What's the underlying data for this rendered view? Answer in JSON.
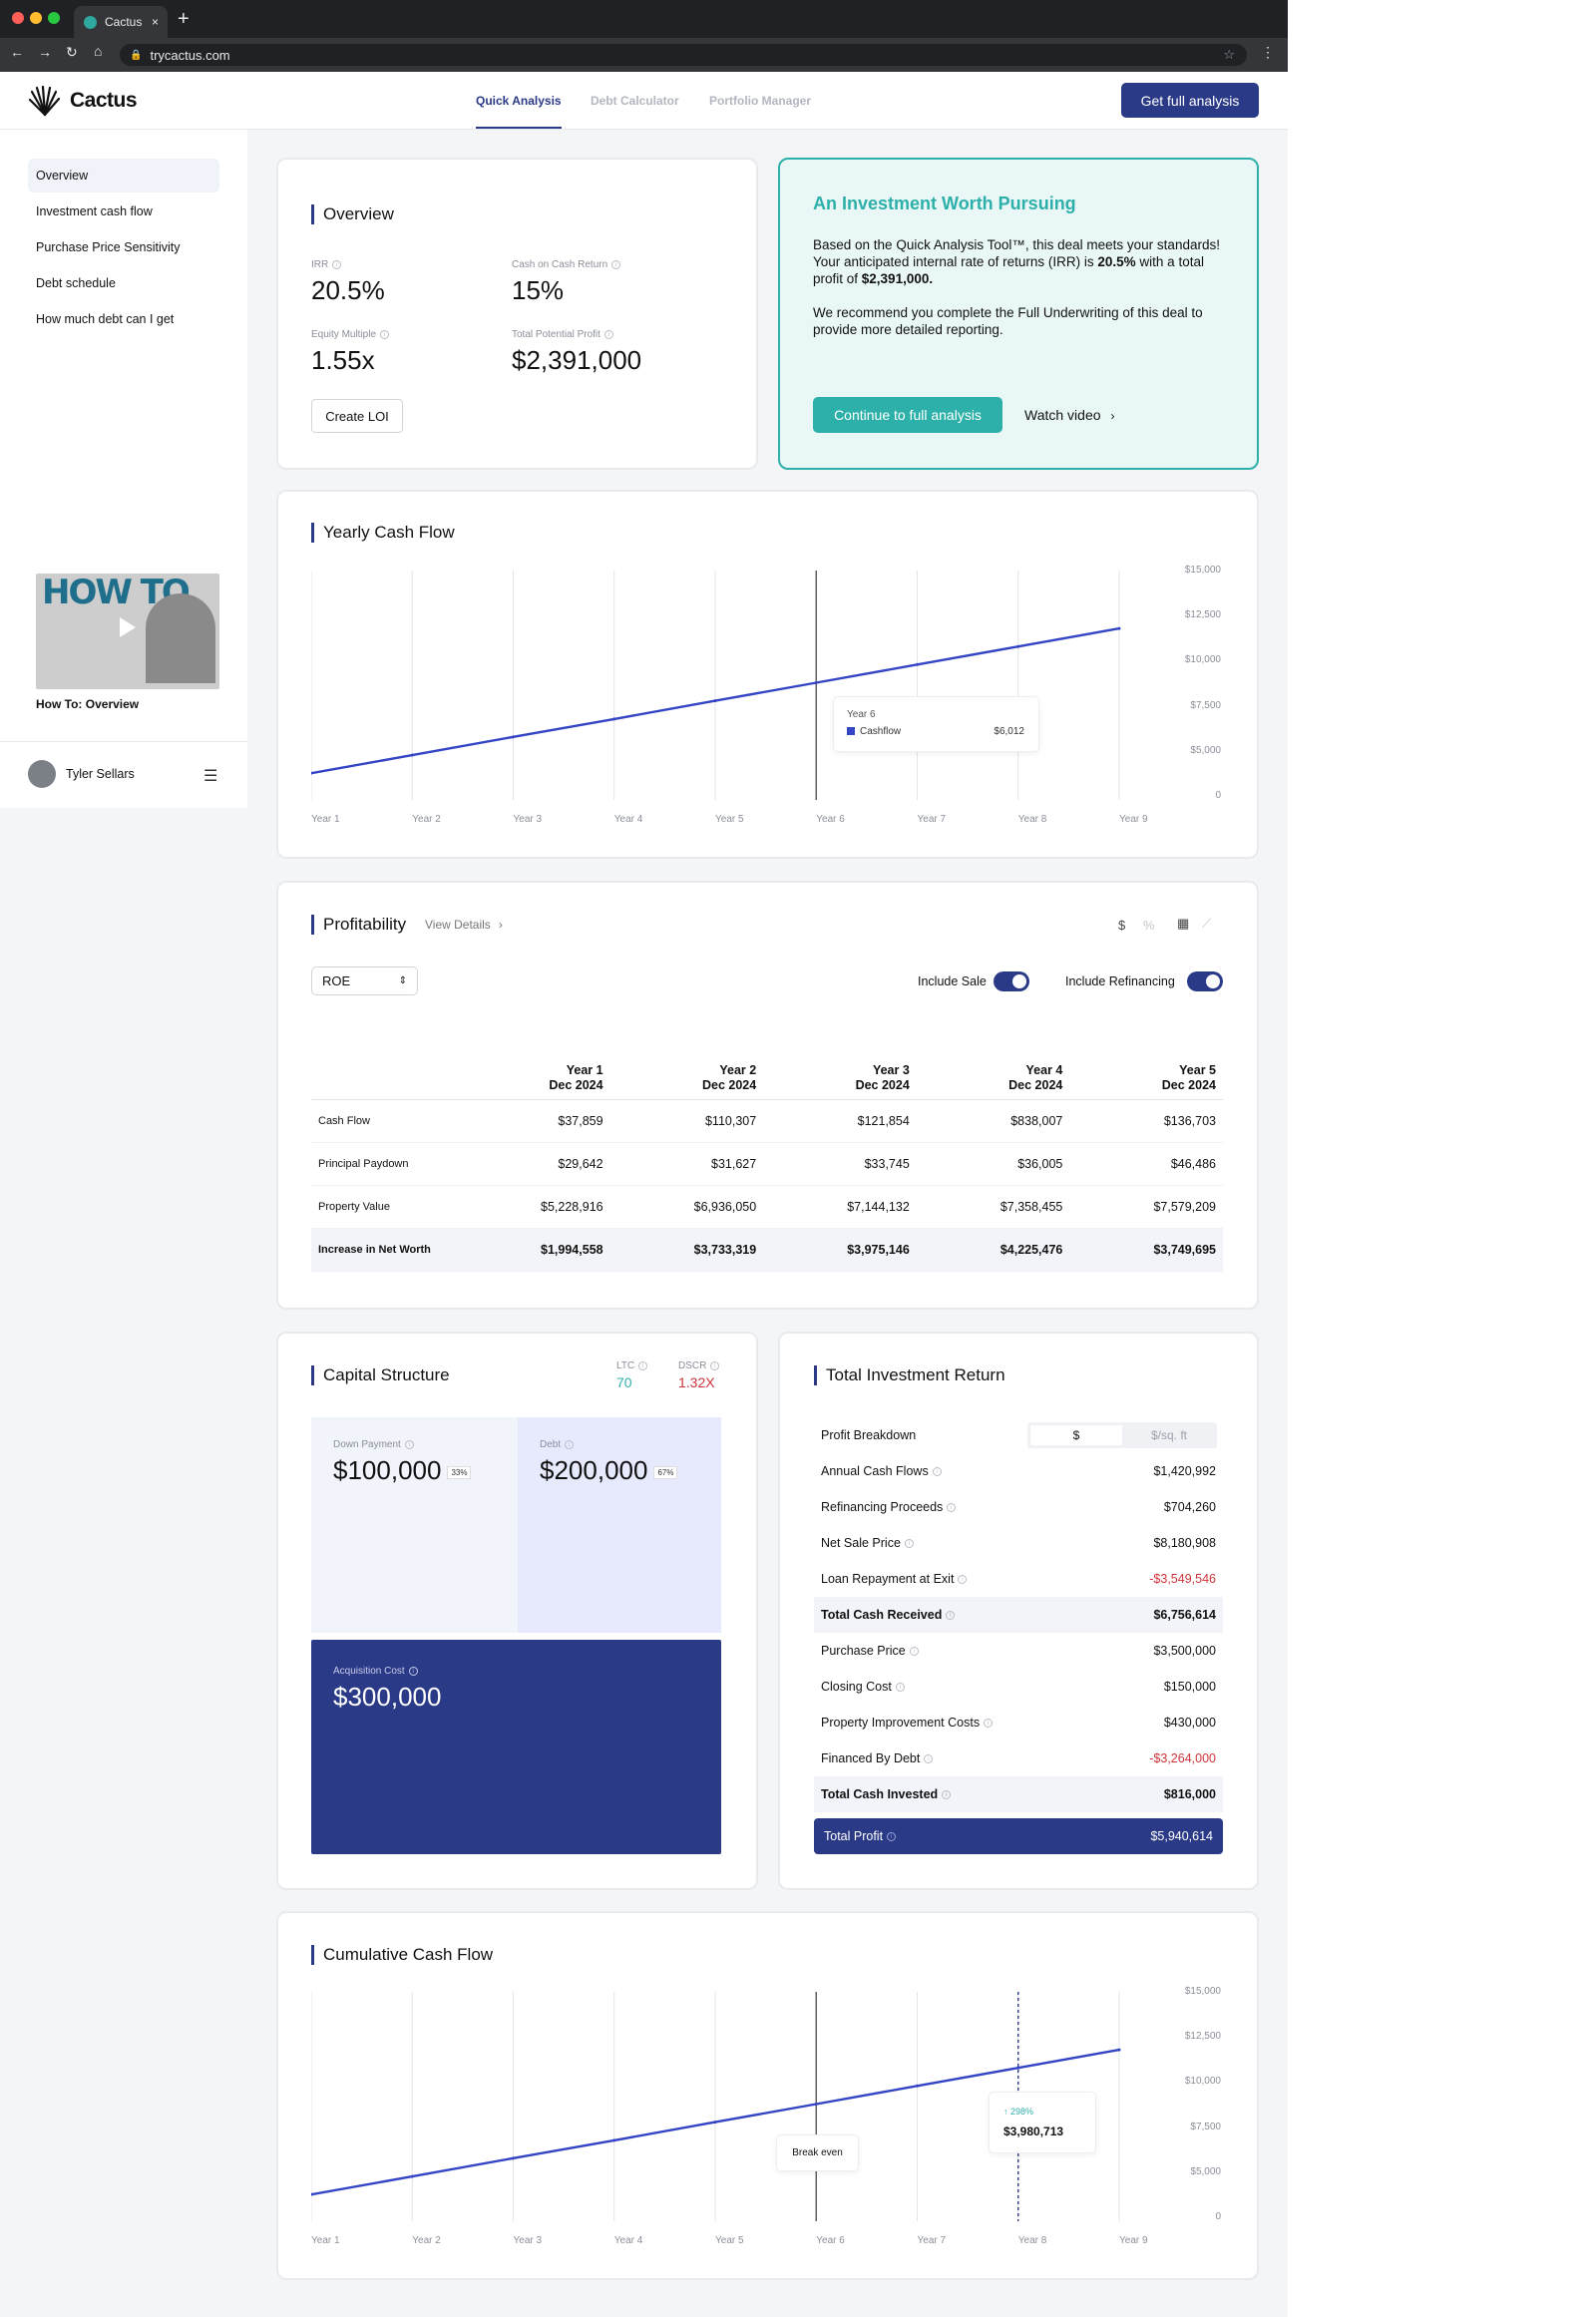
{
  "browser": {
    "tab_title": "Cactus",
    "url": "trycactus.com",
    "new_tab": "+",
    "close": "×"
  },
  "header": {
    "logo": "Cactus",
    "tabs": [
      "Quick Analysis",
      "Debt Calculator",
      "Portfolio Manager"
    ],
    "cta": "Get full analysis"
  },
  "sidebar": {
    "items": [
      "Overview",
      "Investment cash flow",
      "Purchase Price Sensitivity",
      "Debt schedule",
      "How much debt can I get"
    ],
    "video_caption": "How To: Overview",
    "video_text": "HOW TO",
    "user": "Tyler Sellars"
  },
  "overview": {
    "title": "Overview",
    "irr_label": "IRR",
    "irr": "20.5%",
    "coc_label": "Cash on Cash Return",
    "coc": "15%",
    "em_label": "Equity Multiple",
    "em": "1.55x",
    "profit_label": "Total Potential Profit",
    "profit": "$2,391,000",
    "loi": "Create LOI"
  },
  "worth": {
    "title": "An Investment Worth Pursuing",
    "p1a": "Based on the Quick Analysis Tool™, this deal meets your standards!  Your anticipated internal rate of returns (IRR) is ",
    "p1b": "20.5%",
    "p1c": " with a total profit of ",
    "p1d": "$2,391,000.",
    "p2": "We recommend you complete the Full Underwriting of this deal to provide more detailed reporting.",
    "cta": "Continue to full analysis",
    "watch": "Watch video"
  },
  "yearly": {
    "title": "Yearly Cash Flow",
    "tooltip_year": "Year 6",
    "tooltip_series": "Cashflow",
    "tooltip_value": "$6,012"
  },
  "cumulative": {
    "title": "Cumulative Cash Flow",
    "break_even": "Break even",
    "badge_pct": "↑ 298%",
    "badge_value": "$3,980,713"
  },
  "chart_data": [
    {
      "type": "line",
      "title": "Yearly Cash Flow",
      "x": [
        "Year 1",
        "Year 2",
        "Year 3",
        "Year 4",
        "Year 5",
        "Year 6",
        "Year 7",
        "Year 8",
        "Year 9"
      ],
      "y_ticks": [
        "$15,000",
        "$12,500",
        "$10,000",
        "$7,500",
        "$5,000",
        "0"
      ],
      "ylim": [
        0,
        15000
      ],
      "series": [
        {
          "name": "Cashflow",
          "values": [
            1750,
            2930,
            4120,
            5290,
            6480,
            7660,
            8850,
            10030,
            11210
          ]
        }
      ],
      "color": "#3344c4"
    },
    {
      "type": "line",
      "title": "Cumulative Cash Flow",
      "x": [
        "Year 1",
        "Year 2",
        "Year 3",
        "Year 4",
        "Year 5",
        "Year 6",
        "Year 7",
        "Year 8",
        "Year 9"
      ],
      "y_ticks": [
        "$15,000",
        "$12,500",
        "$10,000",
        "$7,500",
        "$5,000",
        "0"
      ],
      "ylim": [
        0,
        15000
      ],
      "series": [
        {
          "values": [
            1750,
            2930,
            4120,
            5290,
            6480,
            7660,
            8850,
            10030,
            11210
          ]
        }
      ],
      "color": "#3344c4"
    }
  ],
  "profitability": {
    "title": "Profitability",
    "view_details": "View Details",
    "unit_dollar": "$",
    "unit_pct": "%",
    "select": "ROE",
    "include_sale": "Include Sale",
    "include_refi": "Include Refinancing",
    "columns": [
      {
        "year": "Year 1",
        "date": "Dec 2024"
      },
      {
        "year": "Year 2",
        "date": "Dec 2024"
      },
      {
        "year": "Year 3",
        "date": "Dec 2024"
      },
      {
        "year": "Year 4",
        "date": "Dec 2024"
      },
      {
        "year": "Year 5",
        "date": "Dec 2024"
      }
    ],
    "rows": [
      {
        "label": "Cash Flow",
        "values": [
          "$37,859",
          "$110,307",
          "$121,854",
          "$838,007",
          "$136,703"
        ]
      },
      {
        "label": "Principal Paydown",
        "values": [
          "$29,642",
          "$31,627",
          "$33,745",
          "$36,005",
          "$46,486"
        ]
      },
      {
        "label": "Property Value",
        "values": [
          "$5,228,916",
          "$6,936,050",
          "$7,144,132",
          "$7,358,455",
          "$7,579,209"
        ]
      },
      {
        "label": "Increase in Net Worth",
        "values": [
          "$1,994,558",
          "$3,733,319",
          "$3,975,146",
          "$4,225,476",
          "$3,749,695"
        ]
      }
    ]
  },
  "capital": {
    "title": "Capital Structure",
    "ltc_label": "LTC",
    "ltc": "70",
    "dscr_label": "DSCR",
    "dscr": "1.32X",
    "down_label": "Down Payment",
    "down": "$100,000",
    "down_pct": "33%",
    "debt_label": "Debt",
    "debt": "$200,000",
    "debt_pct": "67%",
    "acq_label": "Acquisition Cost",
    "acq": "$300,000"
  },
  "total_return": {
    "title": "Total Investment Return",
    "breakdown": "Profit Breakdown",
    "seg_a": "$",
    "seg_b": "$/sq. ft",
    "rows": [
      {
        "label": "Annual Cash Flows",
        "value": "$1,420,992"
      },
      {
        "label": "Refinancing Proceeds",
        "value": "$704,260"
      },
      {
        "label": "Net Sale Price",
        "value": "$8,180,908"
      },
      {
        "label": "Loan Repayment at Exit",
        "value": "-$3,549,546"
      },
      {
        "label": "Total Cash Received",
        "value": "$6,756,614"
      },
      {
        "label": "Purchase Price",
        "value": "$3,500,000"
      },
      {
        "label": "Closing Cost",
        "value": "$150,000"
      },
      {
        "label": "Property Improvement Costs",
        "value": "$430,000"
      },
      {
        "label": "Financed By Debt",
        "value": "-$3,264,000"
      },
      {
        "label": "Total Cash Invested",
        "value": "$816,000"
      }
    ],
    "total_label": "Total Profit",
    "total_value": "$5,940,614"
  }
}
